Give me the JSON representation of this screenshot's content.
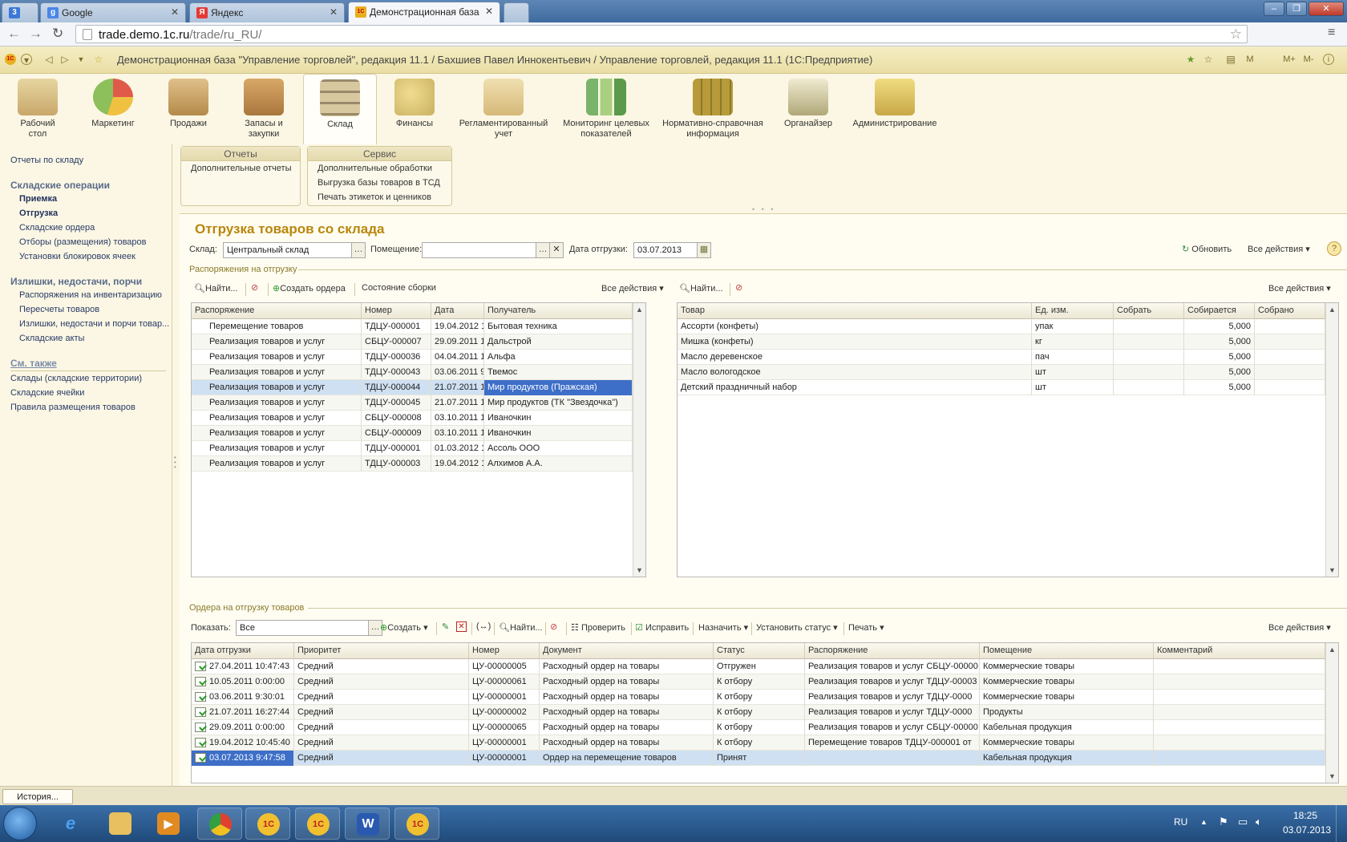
{
  "browser": {
    "tabs": [
      {
        "label": "",
        "icon": "3"
      },
      {
        "label": "Google",
        "icon": "g"
      },
      {
        "label": "Яндекс",
        "icon": "Я"
      },
      {
        "label": "Демонстрационная база",
        "icon": "1С"
      }
    ],
    "url_host": "trade.demo.1c.ru",
    "url_path": "/trade/ru_RU/"
  },
  "app_title": "Демонстрационная база \"Управление торговлей\", редакция 11.1 / Бахшиев Павел Иннокентьевич / Управление торговлей, редакция 11.1 (1С:Предприятие)",
  "titlebar_buttons": {
    "m": "M",
    "mplus": "M+",
    "mminus": "M-",
    "info": "i"
  },
  "sections": [
    {
      "line1": "Рабочий",
      "line2": "стол",
      "color": "#c9a86a"
    },
    {
      "line1": "Маркетинг",
      "line2": "",
      "color": "#8dbf5a"
    },
    {
      "line1": "Продажи",
      "line2": "",
      "color": "#b48a4a"
    },
    {
      "line1": "Запасы и",
      "line2": "закупки",
      "color": "#a9773c"
    },
    {
      "line1": "Склад",
      "line2": "",
      "color": "#9a8a6a"
    },
    {
      "line1": "Финансы",
      "line2": "",
      "color": "#c9b060"
    },
    {
      "line1": "Регламентированный",
      "line2": "учет",
      "color": "#d6b878"
    },
    {
      "line1": "Мониторинг целевых",
      "line2": "показателей",
      "color": "#7ab36a"
    },
    {
      "line1": "Нормативно-справочная",
      "line2": "информация",
      "color": "#b89a3a"
    },
    {
      "line1": "Органайзер",
      "line2": "",
      "color": "#b0a878"
    },
    {
      "line1": "Администрирование",
      "line2": "",
      "color": "#c8a848"
    }
  ],
  "leftnav": {
    "top_link": "Отчеты по складу",
    "group1": "Складские операции",
    "g1_items": [
      "Приемка",
      "Отгрузка",
      "Складские ордера",
      "Отборы (размещения) товаров",
      "Установки блокировок ячеек"
    ],
    "group2": "Излишки, недостачи, порчи",
    "g2_items": [
      "Распоряжения на инвентаризацию",
      "Пересчеты товаров",
      "Излишки, недостачи и порчи товар...",
      "Складские акты"
    ],
    "group3": "См. также",
    "g3_items": [
      "Склады (складские территории)",
      "Складские ячейки",
      "Правила размещения товаров"
    ]
  },
  "panels": {
    "reports": {
      "title": "Отчеты",
      "items": [
        "Дополнительные отчеты"
      ]
    },
    "service": {
      "title": "Сервис",
      "items": [
        "Дополнительные обработки",
        "Выгрузка базы товаров в ТСД",
        "Печать этикеток и ценников"
      ]
    }
  },
  "form": {
    "title": "Отгрузка товаров со склада",
    "warehouse_label": "Склад:",
    "warehouse_value": "Центральный склад",
    "room_label": "Помещение:",
    "room_value": "",
    "date_label": "Дата отгрузки:",
    "date_value": "03.07.2013",
    "refresh": "Обновить",
    "all_actions": "Все действия",
    "help": "?"
  },
  "orders_section": {
    "header": "Распоряжения на отгрузку",
    "toolbar": {
      "find": "Найти...",
      "create_order": "Создать ордера",
      "assembly_state": "Состояние сборки",
      "all_actions": "Все действия"
    },
    "columns": [
      "Распоряжение",
      "Номер",
      "Дата",
      "Получатель"
    ],
    "rows": [
      [
        "Перемещение товаров",
        "ТДЦУ-000001",
        "19.04.2012 1",
        "Бытовая техника"
      ],
      [
        "Реализация товаров и услуг",
        "СБЦУ-000007",
        "29.09.2011 1",
        "Дальстрой"
      ],
      [
        "Реализация товаров и услуг",
        "ТДЦУ-000036",
        "04.04.2011 1",
        "Альфа"
      ],
      [
        "Реализация товаров и услуг",
        "ТДЦУ-000043",
        "03.06.2011 9",
        "Твемос"
      ],
      [
        "Реализация товаров и услуг",
        "ТДЦУ-000044",
        "21.07.2011 1",
        "Мир продуктов (Пражская)"
      ],
      [
        "Реализация товаров и услуг",
        "ТДЦУ-000045",
        "21.07.2011 1",
        "Мир продуктов (ТК \"Звездочка\")"
      ],
      [
        "Реализация товаров и услуг",
        "СБЦУ-000008",
        "03.10.2011 1",
        "Иваночкин"
      ],
      [
        "Реализация товаров и услуг",
        "СБЦУ-000009",
        "03.10.2011 1",
        "Иваночкин"
      ],
      [
        "Реализация товаров и услуг",
        "ТДЦУ-000001",
        "01.03.2012 1",
        "Ассоль ООО"
      ],
      [
        "Реализация товаров и услуг",
        "ТДЦУ-000003",
        "19.04.2012 1",
        "Алхимов А.А."
      ]
    ],
    "selected_row": 4
  },
  "goods_section": {
    "toolbar": {
      "find": "Найти...",
      "all_actions": "Все действия"
    },
    "columns": [
      "Товар",
      "Ед. изм.",
      "Собрать",
      "Собирается",
      "Собрано"
    ],
    "rows": [
      [
        "Ассорти (конфеты)",
        "упак",
        "",
        "5,000",
        ""
      ],
      [
        "Мишка (конфеты)",
        "кг",
        "",
        "5,000",
        ""
      ],
      [
        "Масло деревенское",
        "пач",
        "",
        "5,000",
        ""
      ],
      [
        "Масло вологодское",
        "шт",
        "",
        "5,000",
        ""
      ],
      [
        "Детский праздничный набор",
        "шт",
        "",
        "5,000",
        ""
      ]
    ]
  },
  "shipment_section": {
    "header": "Ордера на отгрузку товаров",
    "show_label": "Показать:",
    "show_value": "Все",
    "toolbar": {
      "create": "Создать",
      "find": "Найти...",
      "check": "Проверить",
      "fix": "Исправить",
      "assign": "Назначить",
      "set_status": "Установить статус",
      "print": "Печать",
      "all_actions": "Все действия"
    },
    "columns": [
      "Дата отгрузки",
      "Приоритет",
      "Номер",
      "Документ",
      "Статус",
      "Распоряжение",
      "Помещение",
      "Комментарий"
    ],
    "rows": [
      [
        "27.04.2011 10:47:43",
        "Средний",
        "ЦУ-00000005",
        "Расходный ордер на товары",
        "Отгружен",
        "Реализация товаров и услуг СБЦУ-00000",
        "Коммерческие товары",
        ""
      ],
      [
        "10.05.2011 0:00:00",
        "Средний",
        "ЦУ-00000061",
        "Расходный ордер на товары",
        "К отбору",
        "Реализация товаров и услуг ТДЦУ-00003",
        "Коммерческие товары",
        ""
      ],
      [
        "03.06.2011 9:30:01",
        "Средний",
        "ЦУ-00000001",
        "Расходный ордер на товары",
        "К отбору",
        "Реализация товаров и услуг ТДЦУ-0000",
        "Коммерческие товары",
        ""
      ],
      [
        "21.07.2011 16:27:44",
        "Средний",
        "ЦУ-00000002",
        "Расходный ордер на товары",
        "К отбору",
        "Реализация товаров и услуг ТДЦУ-0000",
        "Продукты",
        ""
      ],
      [
        "29.09.2011 0:00:00",
        "Средний",
        "ЦУ-00000065",
        "Расходный ордер на товары",
        "К отбору",
        "Реализация товаров и услуг СБЦУ-00000",
        "Кабельная продукция",
        ""
      ],
      [
        "19.04.2012 10:45:40",
        "Средний",
        "ЦУ-00000001",
        "Расходный ордер на товары",
        "К отбору",
        "Перемещение товаров ТДЦУ-000001 от",
        "Коммерческие товары",
        ""
      ],
      [
        "03.07.2013 9:47:58",
        "Средний",
        "ЦУ-00000001",
        "Ордер на перемещение товаров",
        "Принят",
        "",
        "Кабельная продукция",
        ""
      ]
    ],
    "selected_row": 6
  },
  "history_button": "История...",
  "taskbar": {
    "lang": "RU",
    "time": "18:25",
    "date": "03.07.2013"
  }
}
